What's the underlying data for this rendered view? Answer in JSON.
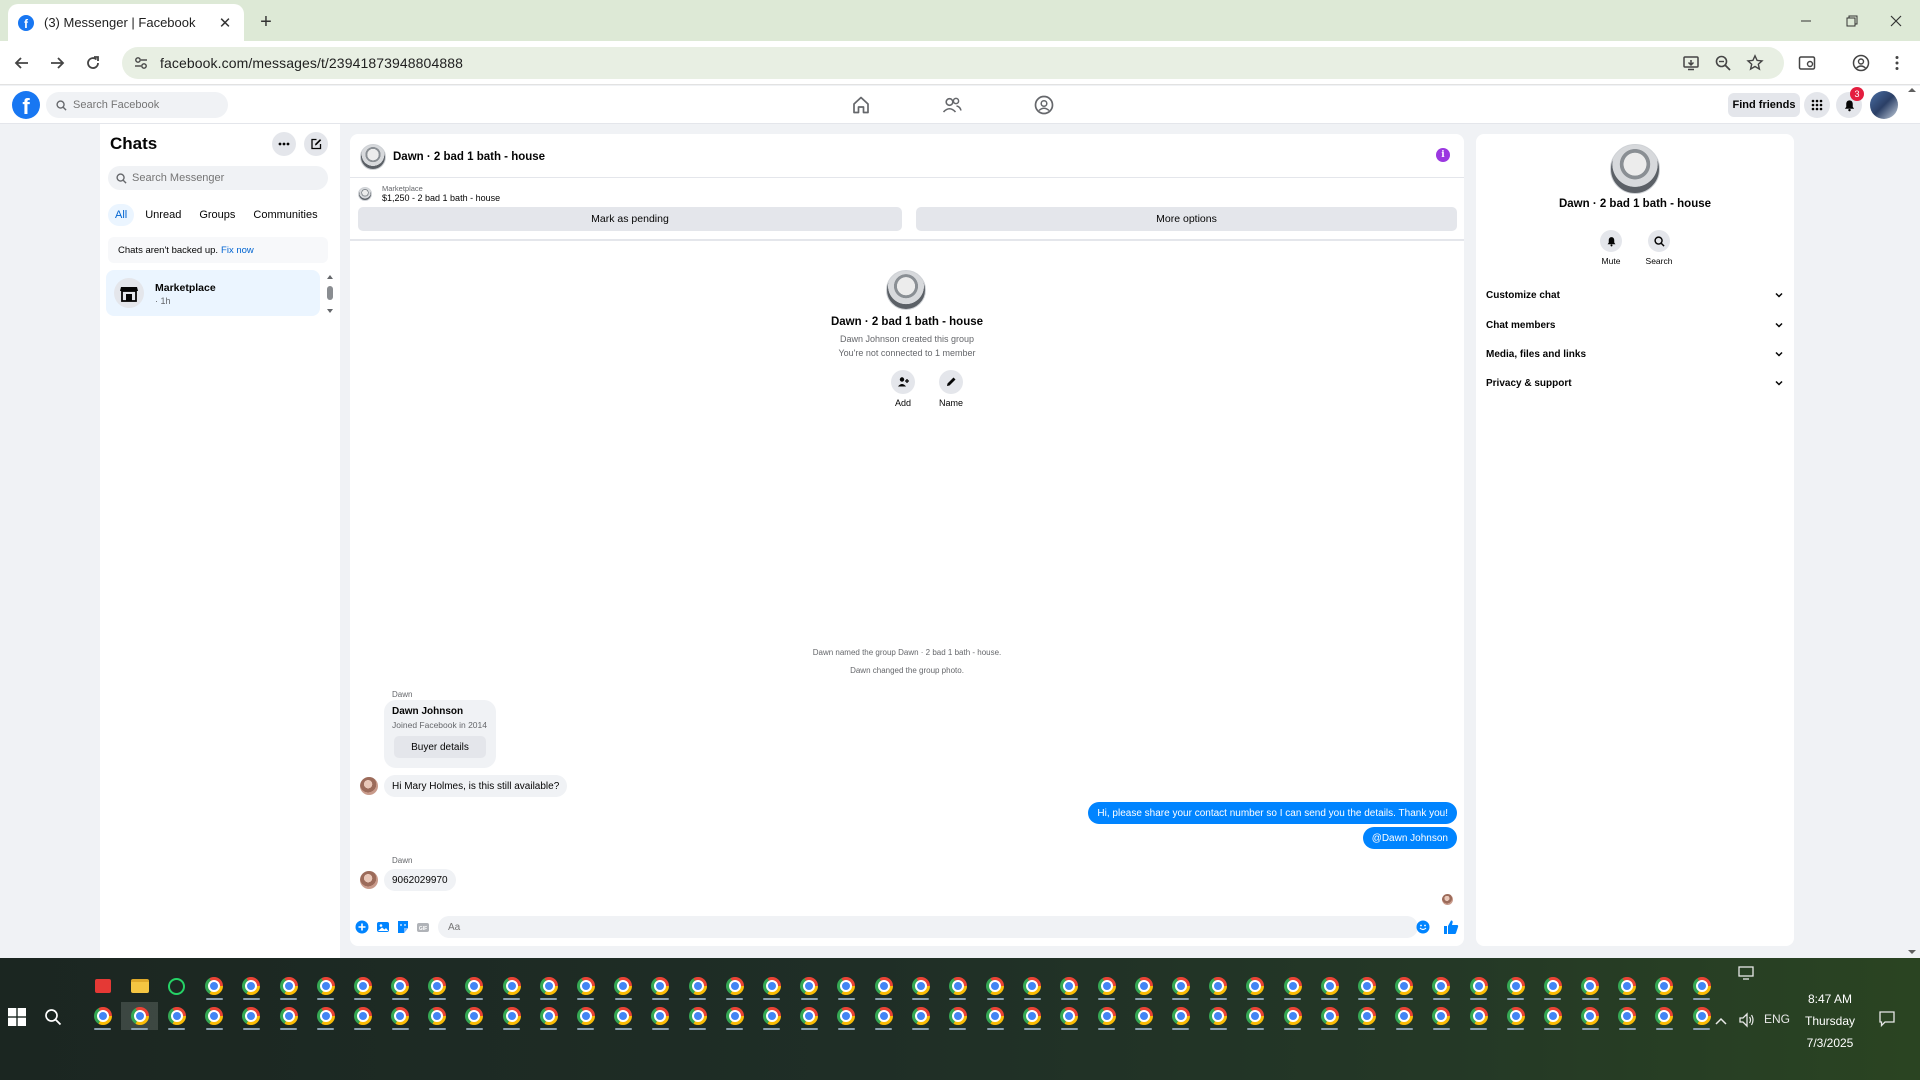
{
  "browser": {
    "tab_title": "(3) Messenger | Facebook",
    "url": "facebook.com/messages/t/23941873948804888"
  },
  "fb": {
    "search_placeholder": "Search Facebook",
    "find_friends": "Find friends",
    "notif_count": "3"
  },
  "chats": {
    "title": "Chats",
    "search_placeholder": "Search Messenger",
    "filters": [
      "All",
      "Unread",
      "Groups",
      "Communities"
    ],
    "backup_text": "Chats aren't backed up.",
    "backup_link": "Fix now",
    "items": [
      {
        "name": "Marketplace",
        "time": "· 1h"
      }
    ]
  },
  "conversation": {
    "title": "Dawn · 2 bad 1 bath - house",
    "marketplace_label": "Marketplace",
    "listing": "$1,250 - 2 bad 1 bath - house",
    "mark_pending": "Mark as pending",
    "more_options": "More options",
    "hero": {
      "title": "Dawn · 2 bad 1 bath - house",
      "created": "Dawn Johnson created this group",
      "connected": "You're not connected to 1 member",
      "add": "Add",
      "name": "Name"
    },
    "system": [
      "Dawn named the group Dawn · 2 bad 1 bath - house.",
      "Dawn changed the group photo."
    ],
    "card": {
      "sender": "Dawn",
      "name": "Dawn Johnson",
      "joined": "Joined Facebook in 2014",
      "button": "Buyer details"
    },
    "messages": [
      {
        "dir": "in",
        "text": "Hi Mary Holmes, is this still available?"
      },
      {
        "dir": "out",
        "text": "Hi, please share your contact number so I can send you the details. Thank you!"
      },
      {
        "dir": "out",
        "text": "@Dawn Johnson"
      },
      {
        "dir": "in",
        "sender": "Dawn",
        "text": "9062029970"
      }
    ],
    "input_placeholder": "Aa"
  },
  "info_panel": {
    "title": "Dawn · 2 bad 1 bath - house",
    "mute": "Mute",
    "search": "Search",
    "sections": [
      "Customize chat",
      "Chat members",
      "Media, files and links",
      "Privacy & support"
    ]
  },
  "taskbar": {
    "lang": "ENG",
    "time": "8:47 AM",
    "day": "Thursday",
    "date": "7/3/2025"
  },
  "colors": {
    "fb_blue": "#1877f2",
    "messenger_blue": "#0084ff",
    "info_purple": "#9b38e0",
    "notif_red": "#e41e3f"
  }
}
